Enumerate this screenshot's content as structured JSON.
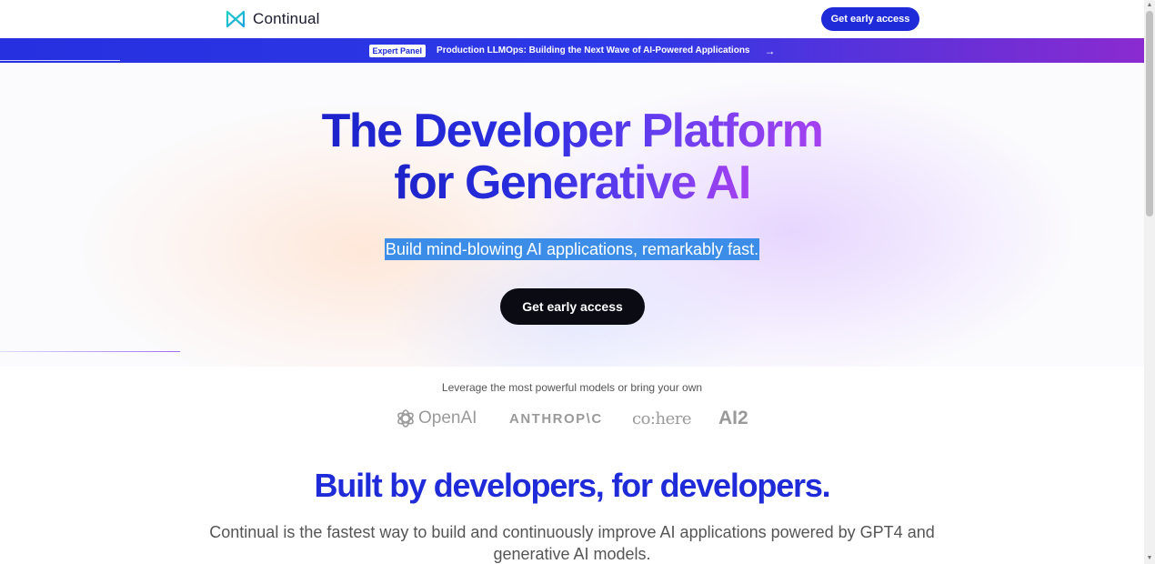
{
  "header": {
    "brand": "Continual",
    "cta_label": "Get early access"
  },
  "banner": {
    "badge": "Expert Panel",
    "text": "Production LLMOps: Building the Next Wave of AI-Powered Applications",
    "arrow": "→"
  },
  "hero": {
    "title_line1_a": "The Developer ",
    "title_line1_b": "Platform",
    "title_line2": "for Generative AI",
    "subtitle": "Build mind-blowing AI applications, remarkably fast.",
    "cta_label": "Get early access"
  },
  "models": {
    "caption": "Leverage the most powerful models or bring your own",
    "logos": [
      "OpenAI",
      "ANTHROP\\C",
      "co:here",
      "AI2"
    ]
  },
  "section": {
    "title": "Built by developers, for developers.",
    "body": "Continual is the fastest way to build and continuously improve AI applications powered by GPT4 and generative AI models."
  },
  "colors": {
    "accent": "#1f2bd8",
    "banner_end": "#8a2bd0",
    "dark_button": "#0b0b14",
    "selection": "#3b8de8"
  }
}
